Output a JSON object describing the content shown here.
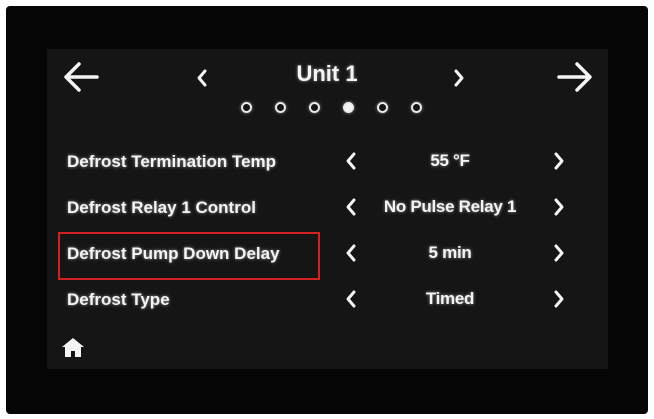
{
  "header": {
    "title": "Unit 1",
    "page_count": 6,
    "active_page": 4
  },
  "settings": [
    {
      "label": "Defrost Termination Temp",
      "value": "55 °F"
    },
    {
      "label": "Defrost Relay 1 Control",
      "value": "No Pulse Relay 1"
    },
    {
      "label": "Defrost Pump Down Delay",
      "value": "5 min"
    },
    {
      "label": "Defrost Type",
      "value": "Timed"
    }
  ],
  "highlighted_row": 2,
  "colors": {
    "screen_bg": "#151515",
    "text": "#f4f4f4",
    "highlight": "#d42020"
  },
  "icons": {
    "back": "arrow-left-icon",
    "forward": "arrow-right-icon",
    "prev_unit": "chevron-left-icon",
    "next_unit": "chevron-right-icon",
    "decrement": "chevron-left-icon",
    "increment": "chevron-right-icon",
    "home": "home-icon"
  }
}
